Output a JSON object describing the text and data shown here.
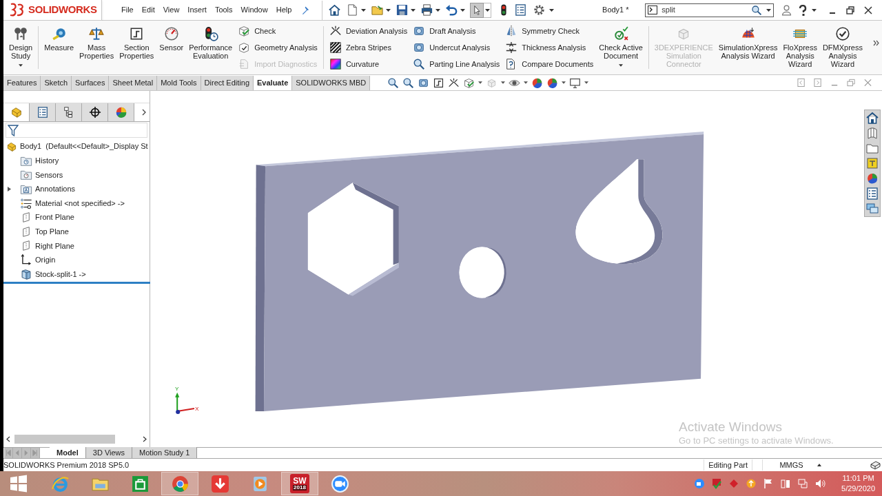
{
  "logo_text": "SOLIDWORKS",
  "menu": [
    "File",
    "Edit",
    "View",
    "Insert",
    "Tools",
    "Window",
    "Help"
  ],
  "document_title": "Body1 *",
  "search": {
    "value": "split"
  },
  "ribbon": [
    {
      "kind": "large",
      "label": "Design\nStudy",
      "disabled": false,
      "dropdown": true
    },
    {
      "kind": "separator"
    },
    {
      "kind": "large",
      "label": "Measure",
      "disabled": false,
      "dropdown": false
    },
    {
      "kind": "large",
      "label": "Mass\nProperties",
      "disabled": false,
      "dropdown": false
    },
    {
      "kind": "large",
      "label": "Section\nProperties",
      "disabled": false,
      "dropdown": false
    },
    {
      "kind": "large",
      "label": "Sensor",
      "disabled": false,
      "dropdown": false
    },
    {
      "kind": "large",
      "label": "Performance\nEvaluation",
      "disabled": false,
      "dropdown": false
    },
    {
      "kind": "column",
      "items": [
        {
          "label": "Check",
          "disabled": false
        },
        {
          "label": "Geometry Analysis",
          "disabled": false
        },
        {
          "label": "Import Diagnostics",
          "disabled": true
        }
      ]
    },
    {
      "kind": "separator"
    },
    {
      "kind": "column",
      "items": [
        {
          "label": "Deviation Analysis",
          "disabled": false
        },
        {
          "label": "Zebra Stripes",
          "disabled": false
        },
        {
          "label": "Curvature",
          "disabled": false
        }
      ]
    },
    {
      "kind": "column",
      "items": [
        {
          "label": "Draft Analysis",
          "disabled": false
        },
        {
          "label": "Undercut Analysis",
          "disabled": false
        },
        {
          "label": "Parting Line Analysis",
          "disabled": false
        }
      ]
    },
    {
      "kind": "column",
      "items": [
        {
          "label": "Symmetry Check",
          "disabled": false
        },
        {
          "label": "Thickness Analysis",
          "disabled": false
        },
        {
          "label": "Compare Documents",
          "disabled": false
        }
      ]
    },
    {
      "kind": "large",
      "label": "Check Active\nDocument",
      "disabled": false,
      "dropdown": true
    },
    {
      "kind": "separator"
    },
    {
      "kind": "large",
      "label": "3DEXPERIENCE\nSimulation\nConnector",
      "disabled": true,
      "dropdown": false
    },
    {
      "kind": "large",
      "label": "SimulationXpress\nAnalysis Wizard",
      "disabled": false,
      "dropdown": false
    },
    {
      "kind": "large",
      "label": "FloXpress\nAnalysis\nWizard",
      "disabled": false,
      "dropdown": false
    },
    {
      "kind": "large",
      "label": "DFMXpress\nAnalysis\nWizard",
      "disabled": false,
      "dropdown": false
    }
  ],
  "command_tabs": [
    {
      "label": "Features",
      "selected": false
    },
    {
      "label": "Sketch",
      "selected": false
    },
    {
      "label": "Surfaces",
      "selected": false
    },
    {
      "label": "Sheet Metal",
      "selected": false
    },
    {
      "label": "Mold Tools",
      "selected": false
    },
    {
      "label": "Direct Editing",
      "selected": false
    },
    {
      "label": "Evaluate",
      "selected": true
    },
    {
      "label": "SOLIDWORKS MBD",
      "selected": false
    }
  ],
  "panel_tabs": [
    {
      "selected": true
    },
    {
      "selected": false
    },
    {
      "selected": false
    },
    {
      "selected": false
    },
    {
      "selected": false
    }
  ],
  "feature_tree": {
    "label": "Body1  (Default<<Default>_Display St",
    "children": [
      {
        "label": "History",
        "collapsed": false
      },
      {
        "label": "Sensors",
        "collapsed": false
      },
      {
        "label": "Annotations",
        "collapsed": true
      },
      {
        "label": "Material <not specified> ->",
        "collapsed": false
      },
      {
        "label": "Front Plane",
        "collapsed": false
      },
      {
        "label": "Top Plane",
        "collapsed": false
      },
      {
        "label": "Right Plane",
        "collapsed": false
      },
      {
        "label": "Origin",
        "collapsed": false
      },
      {
        "label": "Stock-split-1 ->",
        "collapsed": false
      }
    ]
  },
  "triad": {
    "y": "Y",
    "x": "X"
  },
  "activation_notice": {
    "title": "Activate Windows",
    "text": "Go to PC settings to activate Windows."
  },
  "bottom_tabs": [
    {
      "label": "Model",
      "selected": true
    },
    {
      "label": "3D Views",
      "selected": false
    },
    {
      "label": "Motion Study 1",
      "selected": false
    }
  ],
  "status_bar": {
    "text": "SOLIDWORKS Premium 2018 SP5.0",
    "mode": "Editing Part",
    "units": "MMGS"
  },
  "taskbar": {
    "apps": [
      {
        "running": false
      },
      {
        "running": false
      },
      {
        "running": false
      },
      {
        "running": true
      },
      {
        "running": false
      },
      {
        "running": false
      },
      {
        "running": true,
        "logo": "SW",
        "badge": "2018"
      },
      {
        "running": false
      }
    ],
    "time": "11:01 PM",
    "date": "5/29/2020"
  }
}
